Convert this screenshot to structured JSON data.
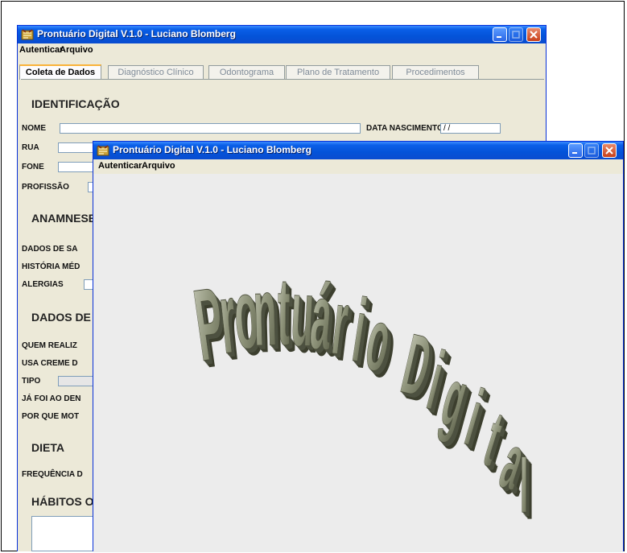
{
  "back_window": {
    "title": "Prontuário Digital V.1.0 - Luciano Blomberg",
    "menu": [
      "Autenticar",
      "Arquivo"
    ],
    "tabs": [
      "Coleta de Dados",
      "Diagnóstico Clínico",
      "Odontograma",
      "Plano de Tratamento",
      "Procedimentos"
    ],
    "sections": {
      "identificacao": "IDENTIFICAÇÃO",
      "anamnese": "ANAMNESE",
      "dados_saude_bucal": "DADOS DE S",
      "dieta": "DIETA",
      "habitos": "HÁBITOS O"
    },
    "labels": {
      "nome": "NOME",
      "data_nascimento": "DATA NASCIMENTO",
      "rua": "RUA",
      "fone": "FONE",
      "profissao": "PROFISSÃO",
      "dados_saude": "DADOS DE SA",
      "historia_medica": "HISTÓRIA MÉD",
      "alergias": "ALERGIAS",
      "quem_realiza": "QUEM REALIZ",
      "usa_creme": "USA CREME D",
      "tipo": "TIPO",
      "ja_foi": "JÁ FOI AO DEN",
      "por_que": "POR QUE MOT",
      "frequencia": "FREQUÊNCIA D"
    },
    "values": {
      "data_nascimento": " / /"
    }
  },
  "front_window": {
    "title": "Prontuário Digital V.1.0 - Luciano Blomberg",
    "menu": [
      "Autenticar",
      "Arquivo"
    ],
    "logo_text": "Prontuário Digital"
  },
  "colors": {
    "titlebar": "#0a5fe8",
    "window_bg": "#ece9d8",
    "active_tab_accent": "#f9b339",
    "logo_fill": "#8a8f76"
  },
  "icons": [
    "app-icon",
    "minimize-icon",
    "maximize-icon",
    "close-icon"
  ]
}
